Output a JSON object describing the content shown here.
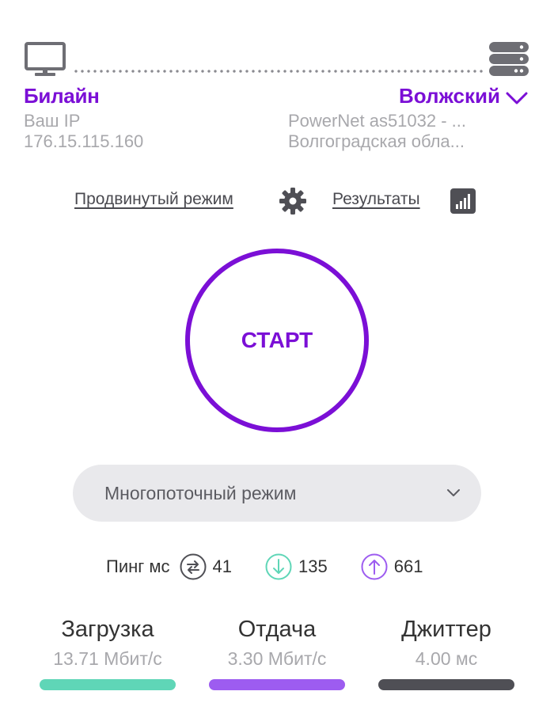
{
  "connection": {
    "isp_name": "Билайн",
    "ip_label": "Ваш IP",
    "ip_value": "176.15.115.160",
    "server_name": "Волжский",
    "server_host": "PowerNet as51032 - ...",
    "server_region": "Волгоградская обла..."
  },
  "links": {
    "advanced_mode": "Продвинутый режим",
    "results": "Результаты"
  },
  "start_button": {
    "label": "СТАРТ"
  },
  "mode_select": {
    "selected": "Многопоточный режим"
  },
  "ping": {
    "label": "Пинг мс",
    "idle": "41",
    "download": "135",
    "upload": "661"
  },
  "metrics": {
    "download": {
      "title": "Загрузка",
      "value": "13.71",
      "unit": "Мбит/с",
      "color": "#5fd6b7"
    },
    "upload": {
      "title": "Отдача",
      "value": "3.30",
      "unit": "Мбит/с",
      "color": "#9d5cf0"
    },
    "jitter": {
      "title": "Джиттер",
      "value": "4.00",
      "unit": "мс",
      "color": "#4f4f55"
    }
  },
  "colors": {
    "accent": "#7b0fd6",
    "icon_grey": "#6e6e74",
    "download_icon": "#5fd6b7",
    "upload_icon": "#9d5cf0"
  },
  "icons": {
    "client": "monitor-icon",
    "server": "server-icon",
    "settings": "gear-icon",
    "results": "bar-chart-icon",
    "idle_ping": "swap-arrows-icon",
    "download_ping": "arrow-down-icon",
    "upload_ping": "arrow-up-icon"
  }
}
